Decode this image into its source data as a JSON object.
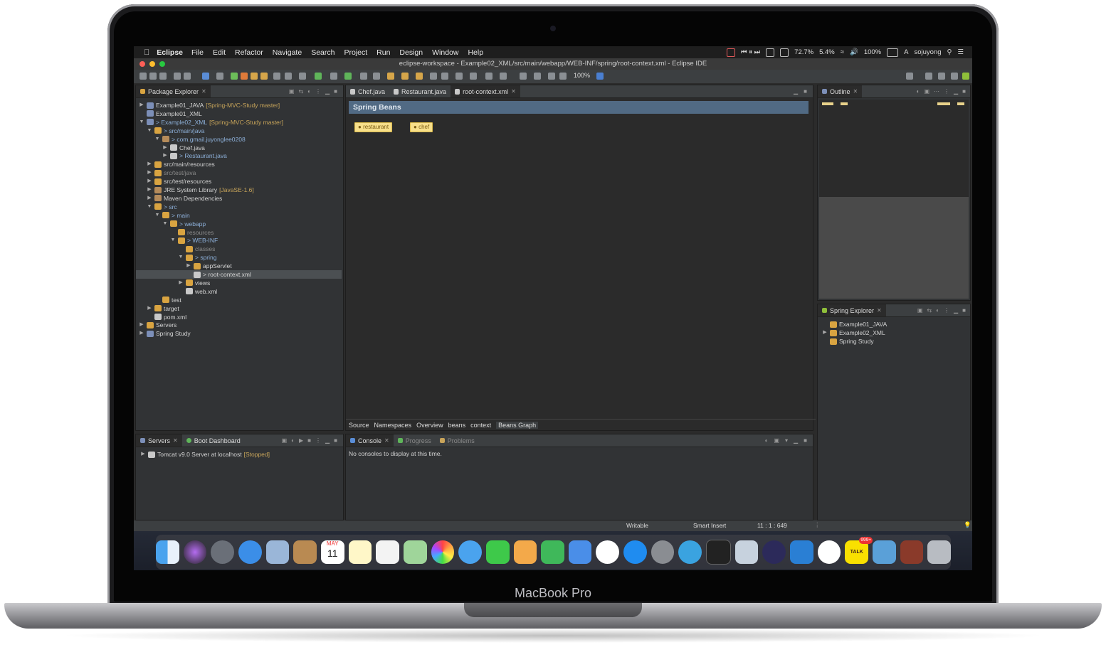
{
  "device": {
    "brand": "MacBook Pro"
  },
  "menubar": {
    "app_name": "Eclipse",
    "menus": [
      "File",
      "Edit",
      "Refactor",
      "Navigate",
      "Search",
      "Project",
      "Run",
      "Design",
      "Window",
      "Help"
    ],
    "status": {
      "cpu": "72.7%",
      "mem": "5.4%",
      "battery": "100%",
      "user": "sojuyong"
    }
  },
  "window": {
    "title": "eclipse-workspace - Example02_XML/src/main/webapp/WEB-INF/spring/root-context.xml - Eclipse IDE"
  },
  "toolbar": {
    "zoom": "100%"
  },
  "package_explorer": {
    "tab": "Package Explorer",
    "items": [
      {
        "label": "Example01_JAVA",
        "suffix": "[Spring-MVC-Study master]",
        "arrow": "▶",
        "depth": 0,
        "icon": "proj"
      },
      {
        "label": "Example01_XML",
        "suffix": "",
        "arrow": "",
        "depth": 0,
        "icon": "proj"
      },
      {
        "label": "> Example02_XML",
        "suffix": "[Spring-MVC-Study master]",
        "arrow": "▼",
        "depth": 0,
        "icon": "proj",
        "blue": true
      },
      {
        "label": "> src/main/java",
        "suffix": "",
        "arrow": "▼",
        "depth": 1,
        "icon": "folder",
        "blue": true
      },
      {
        "label": "> com.gmail.juyonglee0208",
        "suffix": "",
        "arrow": "▼",
        "depth": 2,
        "icon": "jar",
        "blue": true
      },
      {
        "label": "Chef.java",
        "suffix": "",
        "arrow": "▶",
        "depth": 3,
        "icon": "file"
      },
      {
        "label": "> Restaurant.java",
        "suffix": "",
        "arrow": "▶",
        "depth": 3,
        "icon": "file",
        "blue": true
      },
      {
        "label": "src/main/resources",
        "suffix": "",
        "arrow": "▶",
        "depth": 1,
        "icon": "folder"
      },
      {
        "label": "src/test/java",
        "suffix": "",
        "arrow": "▶",
        "depth": 1,
        "icon": "folder",
        "muted": true
      },
      {
        "label": "src/test/resources",
        "suffix": "",
        "arrow": "▶",
        "depth": 1,
        "icon": "folder"
      },
      {
        "label": "JRE System Library",
        "suffix": "[JavaSE-1.6]",
        "arrow": "▶",
        "depth": 1,
        "icon": "jar"
      },
      {
        "label": "Maven Dependencies",
        "suffix": "",
        "arrow": "▶",
        "depth": 1,
        "icon": "jar"
      },
      {
        "label": "> src",
        "suffix": "",
        "arrow": "▼",
        "depth": 1,
        "icon": "folder",
        "blue": true
      },
      {
        "label": "> main",
        "suffix": "",
        "arrow": "▼",
        "depth": 2,
        "icon": "folder",
        "blue": true
      },
      {
        "label": "> webapp",
        "suffix": "",
        "arrow": "▼",
        "depth": 3,
        "icon": "folder",
        "blue": true
      },
      {
        "label": "resources",
        "suffix": "",
        "arrow": "",
        "depth": 4,
        "icon": "folder",
        "muted": true
      },
      {
        "label": "> WEB-INF",
        "suffix": "",
        "arrow": "▼",
        "depth": 4,
        "icon": "folder",
        "blue": true
      },
      {
        "label": "classes",
        "suffix": "",
        "arrow": "",
        "depth": 5,
        "icon": "folder",
        "muted": true
      },
      {
        "label": "> spring",
        "suffix": "",
        "arrow": "▼",
        "depth": 5,
        "icon": "folder",
        "blue": true
      },
      {
        "label": "appServlet",
        "suffix": "",
        "arrow": "▶",
        "depth": 6,
        "icon": "folder"
      },
      {
        "label": "> root-context.xml",
        "suffix": "",
        "arrow": "",
        "depth": 6,
        "icon": "file",
        "selected": true
      },
      {
        "label": "views",
        "suffix": "",
        "arrow": "▶",
        "depth": 5,
        "icon": "folder"
      },
      {
        "label": "web.xml",
        "suffix": "",
        "arrow": "",
        "depth": 5,
        "icon": "file"
      },
      {
        "label": "test",
        "suffix": "",
        "arrow": "",
        "depth": 2,
        "icon": "folder"
      },
      {
        "label": "target",
        "suffix": "",
        "arrow": "▶",
        "depth": 1,
        "icon": "folder"
      },
      {
        "label": "pom.xml",
        "suffix": "",
        "arrow": "",
        "depth": 1,
        "icon": "file"
      },
      {
        "label": "Servers",
        "suffix": "",
        "arrow": "▶",
        "depth": 0,
        "icon": "folder"
      },
      {
        "label": "Spring Study",
        "suffix": "",
        "arrow": "▶",
        "depth": 0,
        "icon": "proj"
      }
    ]
  },
  "editor": {
    "tabs": [
      "Chef.java",
      "Restaurant.java",
      "root-context.xml"
    ],
    "active_tab": 2,
    "header": "Spring Beans",
    "beans": [
      "restaurant",
      "chef"
    ],
    "bottom_tabs": [
      "Source",
      "Namespaces",
      "Overview",
      "beans",
      "context",
      "Beans Graph"
    ]
  },
  "outline": {
    "tab": "Outline"
  },
  "spring_explorer": {
    "tab": "Spring Explorer",
    "items": [
      {
        "label": "Example01_JAVA",
        "arrow": ""
      },
      {
        "label": "Example02_XML",
        "arrow": "▶"
      },
      {
        "label": "Spring Study",
        "arrow": ""
      }
    ]
  },
  "servers": {
    "tabs": [
      "Servers",
      "Boot Dashboard"
    ],
    "item_label": "Tomcat v9.0 Server at localhost",
    "item_status": "[Stopped]"
  },
  "console": {
    "tabs": [
      "Console",
      "Progress",
      "Problems"
    ],
    "message": "No consoles to display at this time."
  },
  "statusbar": {
    "mode": "Writable",
    "insert": "Smart Insert",
    "position": "11 : 1 : 649"
  },
  "dock": {
    "icons": [
      "finder-icon",
      "siri-icon",
      "launchpad-icon",
      "safari-icon",
      "preview-icon",
      "contacts-icon",
      "calendar-icon",
      "notes-icon",
      "reminders-icon",
      "maps-icon",
      "photos-icon",
      "messages-icon",
      "facetime-icon",
      "pages-icon",
      "numbers-icon",
      "keynote-icon",
      "music-icon",
      "app-store-icon",
      "system-preferences-icon",
      "telegram-icon",
      "terminal-icon",
      "preview2-icon",
      "eclipse-icon",
      "vscode-icon",
      "line-icon",
      "kakaotalk-icon",
      "downloads-icon",
      "folder-icon",
      "trash-icon"
    ],
    "calendar_month": "MAY",
    "calendar_day": "11",
    "kakaotalk_badge": "999+",
    "kakaotalk_label": "TALK"
  }
}
